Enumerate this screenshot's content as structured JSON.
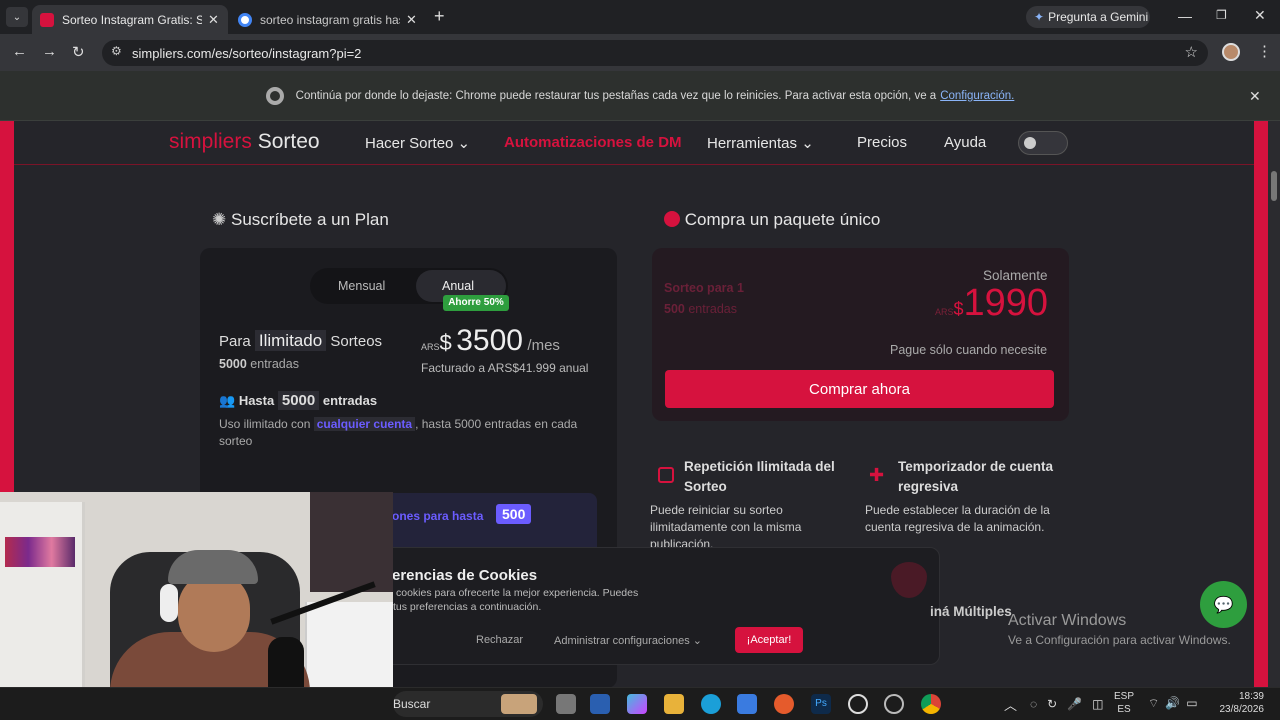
{
  "browser": {
    "tabs": [
      {
        "title": "Sorteo Instagram Gratis: Sorteo"
      },
      {
        "title": "sorteo instagram gratis hasta 5("
      }
    ],
    "new_tab": "+",
    "gemini_label": "Pregunta a Gemini",
    "url": "simpliers.com/es/sorteo/instagram?pi=2",
    "infobar_text": "Continúa por donde lo dejaste: Chrome puede restaurar tus pestañas cada vez que lo reinicies. Para activar esta opción, ve a",
    "infobar_link": "Configuración."
  },
  "site": {
    "logo_a": "simpliers",
    "logo_b": "Sorteo",
    "nav": [
      "Hacer Sorteo",
      "Automatizaciones de DM",
      "Herramientas",
      "Precios",
      "Ayuda"
    ],
    "colors": {
      "accent": "#d6123e",
      "purple": "#6b5cff",
      "green": "#2e9e3e"
    }
  },
  "plan": {
    "heading": "Suscríbete a un Plan",
    "toggle_monthly": "Mensual",
    "toggle_annual": "Anual",
    "save_badge": "Ahorre 50%",
    "para": "Para",
    "ilimitado": "Ilimitado",
    "sorteos": "Sorteos",
    "entries_num": "5000",
    "entries_word": "entradas",
    "currency": "ARS",
    "dollar": "$",
    "price": "3500",
    "per": "/mes",
    "billed": "Facturado a ARS$41.999 anual",
    "hasta": "Hasta",
    "hasta_num": "5000",
    "hasta_word": "entradas",
    "uso_a": "Uso ilimitado con",
    "uso_link": "cualquier cuenta",
    "uso_b": ", hasta 5000 entradas en cada sorteo",
    "promo_text": "ones para hasta",
    "promo_num": "500"
  },
  "single": {
    "heading": "Compra un paquete único",
    "sorteo_para": "Sorteo para",
    "one": "1",
    "entries": "500",
    "entries_word": "entradas",
    "solamente": "Solamente",
    "currency": "ARS",
    "dollar": "$",
    "price": "1990",
    "pay_note": "Pague sólo cuando necesite",
    "buy": "Comprar ahora"
  },
  "features": [
    {
      "title": "Repetición Ilimitada del Sorteo",
      "desc": "Puede reiniciar su sorteo ilimitadamente con la misma publicación."
    },
    {
      "title": "Temporizador de cuenta regresiva",
      "desc": "Puede establecer la duración de la cuenta regresiva de la animación."
    }
  ],
  "feature3_partial": "iná Múltiples",
  "cookies": {
    "title": "ferencias de Cookies",
    "text1": "cookies para ofrecerte la mejor experiencia. Puedes",
    "text2": "tus preferencias a continuación.",
    "reject": "Rechazar",
    "manage": "Administrar configuraciones",
    "accept": "¡Aceptar!"
  },
  "watermark": {
    "line1": "Activar Windows",
    "line2": "Ve a Configuración para activar Windows."
  },
  "taskbar": {
    "search": "Buscar",
    "lang1": "ESP",
    "lang2": "ES",
    "time": "18:39",
    "date": "23/8/2026"
  }
}
